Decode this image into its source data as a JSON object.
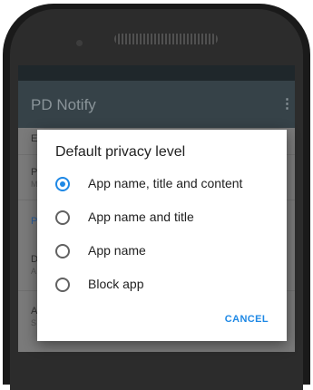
{
  "app": {
    "title": "PD Notify",
    "menu_icon": "more-vert-icon"
  },
  "background": {
    "row1_text": "E",
    "row2_text": "P",
    "row2_sub": "M",
    "section": "P",
    "row3_text": "D",
    "row3_sub": "A",
    "row4_text": "A",
    "row4_sub": "S"
  },
  "dialog": {
    "title": "Default privacy level",
    "options": [
      {
        "label": "App name, title and content",
        "selected": true
      },
      {
        "label": "App name and title",
        "selected": false
      },
      {
        "label": "App name",
        "selected": false
      },
      {
        "label": "Block app",
        "selected": false
      }
    ],
    "cancel_label": "CANCEL"
  },
  "colors": {
    "accent": "#1e88e5",
    "app_bar": "#364248",
    "status_bar": "#1f272b"
  }
}
